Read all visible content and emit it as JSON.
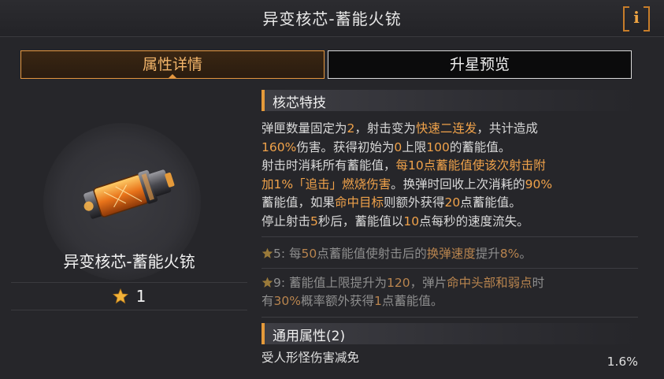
{
  "window": {
    "title": "异变核芯-蓄能火铳",
    "info_label": "i"
  },
  "tabs": [
    {
      "label": "属性详情",
      "active": true
    },
    {
      "label": "升星预览",
      "active": false
    }
  ],
  "item": {
    "name": "异变核芯-蓄能火铳",
    "stars": "1",
    "icon": "energy-core-cartridge"
  },
  "core_skill": {
    "heading": "核芯特技",
    "lines": [
      [
        {
          "t": "弹匣数量固定为"
        },
        {
          "t": "2",
          "hl": true
        },
        {
          "t": "，射击变为"
        },
        {
          "t": "快速二连发",
          "hl": true
        },
        {
          "t": "，共计造成"
        }
      ],
      [
        {
          "t": "160%",
          "hl": true
        },
        {
          "t": "伤害。获得初始为"
        },
        {
          "t": "0",
          "hl": true
        },
        {
          "t": "上限"
        },
        {
          "t": "100",
          "hl": true
        },
        {
          "t": "的蓄能值。"
        }
      ],
      [
        {
          "t": "射击时消耗所有蓄能值，"
        },
        {
          "t": "每10点蓄能值使该次射击附",
          "hl": true
        }
      ],
      [
        {
          "t": "加1%「追击」燃烧伤害",
          "hl": true
        },
        {
          "t": "。换弹时回收上次消耗的"
        },
        {
          "t": "90%",
          "hl": true
        }
      ],
      [
        {
          "t": "蓄能值，如果"
        },
        {
          "t": "命中目标",
          "hl": true
        },
        {
          "t": "则额外获得"
        },
        {
          "t": "20",
          "hl": true
        },
        {
          "t": "点蓄能值。"
        }
      ],
      [
        {
          "t": "停止射击"
        },
        {
          "t": "5",
          "hl": true
        },
        {
          "t": "秒后，蓄能值以"
        },
        {
          "t": "10",
          "hl": true
        },
        {
          "t": "点每秒的速度流失。"
        }
      ]
    ]
  },
  "upgrades": [
    {
      "lines": [
        [
          {
            "t": "5: 每"
          },
          {
            "t": "50",
            "hl": true
          },
          {
            "t": "点蓄能值使射击后的"
          },
          {
            "t": "换弹速度",
            "hl": true
          },
          {
            "t": "提升"
          },
          {
            "t": "8%",
            "hl": true
          },
          {
            "t": "。"
          }
        ]
      ]
    },
    {
      "lines": [
        [
          {
            "t": "9: 蓄能值上限提升为"
          },
          {
            "t": "120",
            "hl": true
          },
          {
            "t": "，弹片"
          },
          {
            "t": "命中头部和弱点",
            "hl": true
          },
          {
            "t": "时"
          }
        ],
        [
          {
            "t": "有"
          },
          {
            "t": "30%",
            "hl": true
          },
          {
            "t": "概率额外获得"
          },
          {
            "t": "1",
            "hl": true
          },
          {
            "t": "点蓄能值。"
          }
        ]
      ]
    }
  ],
  "general": {
    "heading": "通用属性(2)",
    "stats": [
      {
        "name": "受人形怪伤害减免",
        "value": "1.6%"
      }
    ]
  },
  "colors": {
    "accent": "#e59a3a",
    "highlight": "#f0a24a",
    "dim_highlight": "#b8844e",
    "background": "#26262a"
  }
}
